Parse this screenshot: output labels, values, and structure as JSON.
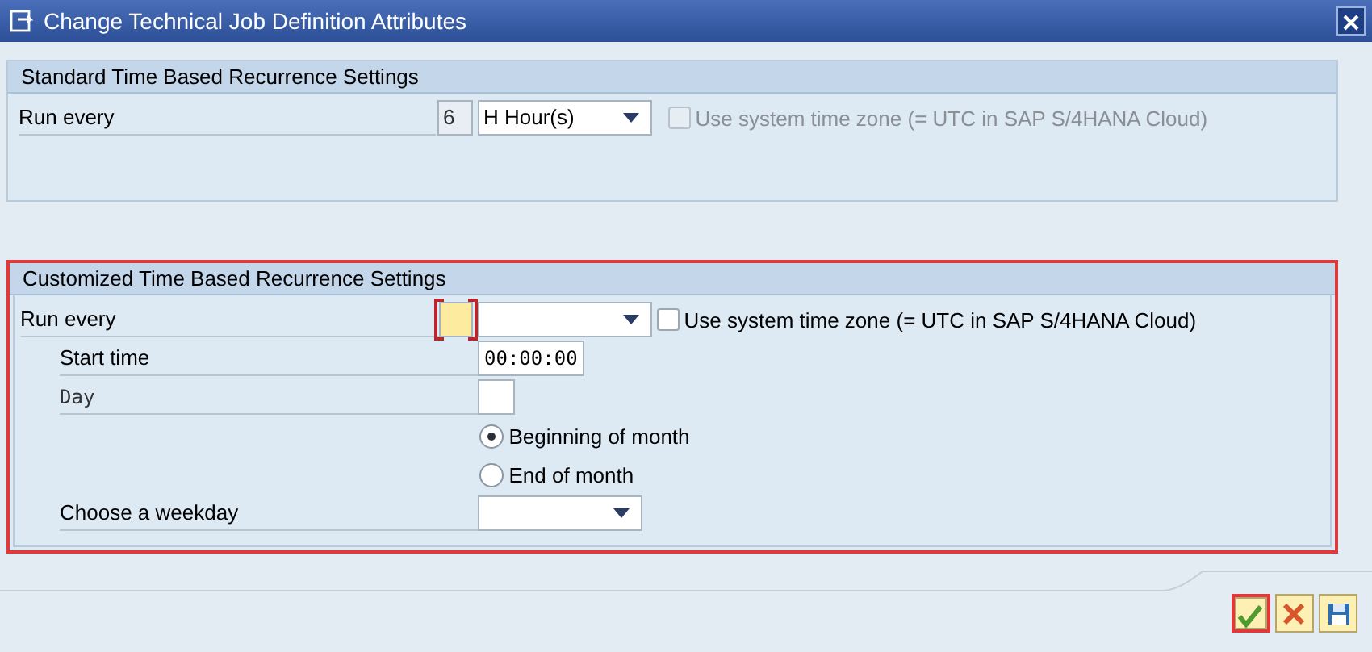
{
  "window": {
    "title": "Change Technical Job Definition Attributes"
  },
  "standard_section": {
    "title": "Standard Time Based Recurrence Settings",
    "run_every": {
      "label": "Run every",
      "value": "6",
      "unit": "H Hour(s)",
      "focused": false
    },
    "time_zone": {
      "label": "Use system time zone (= UTC in SAP S/4HANA Cloud)",
      "checked": false,
      "disabled": true
    }
  },
  "customized_section": {
    "title": "Customized Time Based Recurrence Settings",
    "highlighted": true,
    "run_every": {
      "label": "Run every",
      "focused": true
    },
    "time_zone": {
      "label": "Use system time zone (= UTC in SAP S/4HANA Cloud)",
      "checked": false,
      "disabled": false
    },
    "start_time": {
      "label": "Start time",
      "value": "00:00:00"
    },
    "day": {
      "label": "Day"
    },
    "month_options": [
      {
        "label": "Beginning of month",
        "selected": true
      },
      {
        "label": "End of month",
        "selected": false
      }
    ],
    "weekday": {
      "label": "Choose a weekday"
    }
  },
  "footer_buttons": [
    {
      "kind": "confirm",
      "highlighted": true
    },
    {
      "kind": "cancel",
      "highlighted": false
    },
    {
      "kind": "save",
      "highlighted": false
    }
  ]
}
